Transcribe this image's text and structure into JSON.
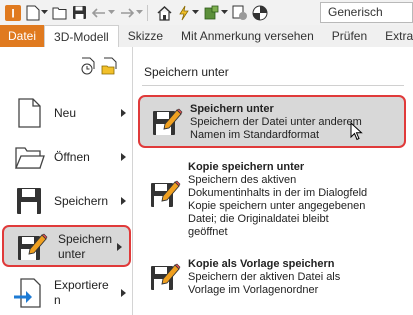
{
  "qat": {
    "profile_combo": "Generisch"
  },
  "tabs": [
    {
      "label": "Datei"
    },
    {
      "label": "3D-Modell"
    },
    {
      "label": "Skizze"
    },
    {
      "label": "Mit Anmerkung versehen"
    },
    {
      "label": "Prüfen"
    },
    {
      "label": "Extras"
    }
  ],
  "left_menu": {
    "items": [
      {
        "label": "Neu"
      },
      {
        "label": "Öffnen"
      },
      {
        "label": "Speichern"
      },
      {
        "label_line1": "Speichern",
        "label_line2": "unter"
      },
      {
        "label_line1": "Exportiere",
        "label_line2": "n"
      }
    ]
  },
  "panel": {
    "title": "Speichern unter",
    "options": [
      {
        "title": "Speichern unter",
        "desc": [
          "Speichern der Datei unter anderem",
          "Namen im Standardformat"
        ]
      },
      {
        "title": "Kopie speichern unter",
        "desc": [
          "Speichern des aktiven",
          "Dokumentinhalts in der im Dialogfeld",
          "Kopie speichern unter angegebenen",
          "Datei; die Originaldatei bleibt",
          "geöffnet"
        ]
      },
      {
        "title": "Kopie als Vorlage speichern",
        "desc": [
          "Speichern der aktiven Datei als",
          "Vorlage im Vorlagenordner"
        ]
      }
    ]
  },
  "colors": {
    "file_tab": "#e07a1f",
    "highlight_border": "#e03a3a",
    "selection_bg": "#d8d8d8",
    "pencil": "#f0a020",
    "export_arrow": "#1e7bd4"
  }
}
